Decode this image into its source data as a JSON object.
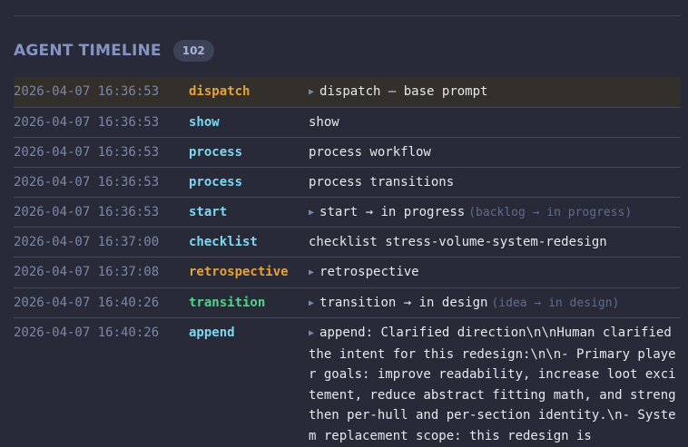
{
  "section": {
    "title": "AGENT TIMELINE",
    "count": "102"
  },
  "colors": {
    "dispatch": "#e6a23a",
    "default_event": "#7fd6f2",
    "transition": "#4fd38a"
  },
  "rows": [
    {
      "timestamp": "2026-04-07 16:36:53",
      "event": "dispatch",
      "message": "dispatch — base prompt",
      "detail": "",
      "expandable": true
    },
    {
      "timestamp": "2026-04-07 16:36:53",
      "event": "show",
      "message": "show",
      "detail": "",
      "expandable": false
    },
    {
      "timestamp": "2026-04-07 16:36:53",
      "event": "process",
      "message": "process workflow",
      "detail": "",
      "expandable": false
    },
    {
      "timestamp": "2026-04-07 16:36:53",
      "event": "process",
      "message": "process transitions",
      "detail": "",
      "expandable": false
    },
    {
      "timestamp": "2026-04-07 16:36:53",
      "event": "start",
      "message": "start → in progress",
      "detail": "(backlog → in progress)",
      "expandable": true
    },
    {
      "timestamp": "2026-04-07 16:37:00",
      "event": "checklist",
      "message": "checklist stress-volume-system-redesign",
      "detail": "",
      "expandable": false
    },
    {
      "timestamp": "2026-04-07 16:37:08",
      "event": "retrospective",
      "message": "retrospective",
      "detail": "",
      "expandable": true
    },
    {
      "timestamp": "2026-04-07 16:40:26",
      "event": "transition",
      "message": "transition → in design",
      "detail": "(idea → in design)",
      "expandable": true
    },
    {
      "timestamp": "2026-04-07 16:40:26",
      "event": "append",
      "message": "append: Clarified direction\\n\\nHuman clarified the intent for this redesign:\\n\\n- Primary player goals: improve readability, increase loot excitement, reduce abstract fitting math, and strengthen per-hull and per-section identity.\\n- System replacement scope: this redesign is",
      "detail": "",
      "expandable": true
    }
  ]
}
